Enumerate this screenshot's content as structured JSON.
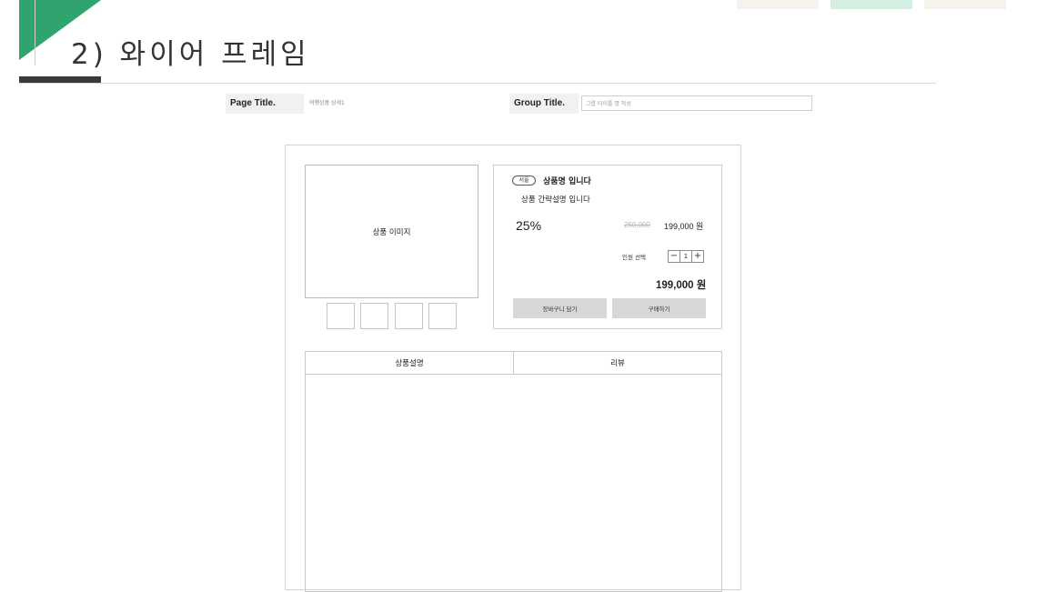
{
  "slide": {
    "title": "2) 와이어 프레임",
    "accent_color": "#2fa46f",
    "tag_colors": [
      "#f5f3ec",
      "#d4efe2",
      "#f5f3ec"
    ]
  },
  "meta": {
    "page_title_label": "Page Title.",
    "page_title_value": "여행상품 상세1",
    "group_title_label": "Group Title.",
    "group_title_placeholder": "그룹 타이틀 명 작성"
  },
  "product": {
    "image_label": "상품 이미지",
    "thumbnail_count": 4,
    "region_badge": "서울",
    "name": "상품명 입니다",
    "short_desc": "상품 간략설명 입니다",
    "discount_rate": "25%",
    "original_price": "250,000",
    "sale_price": "199,000 원",
    "people_label": "인원 선택",
    "stepper": {
      "minus": "−",
      "value": "1",
      "plus": "+"
    },
    "total_price": "199,000 원",
    "cart_button": "장바구니 담기",
    "buy_button": "구매하기"
  },
  "tabs": [
    {
      "label": "상품설명"
    },
    {
      "label": "리뷰"
    }
  ]
}
